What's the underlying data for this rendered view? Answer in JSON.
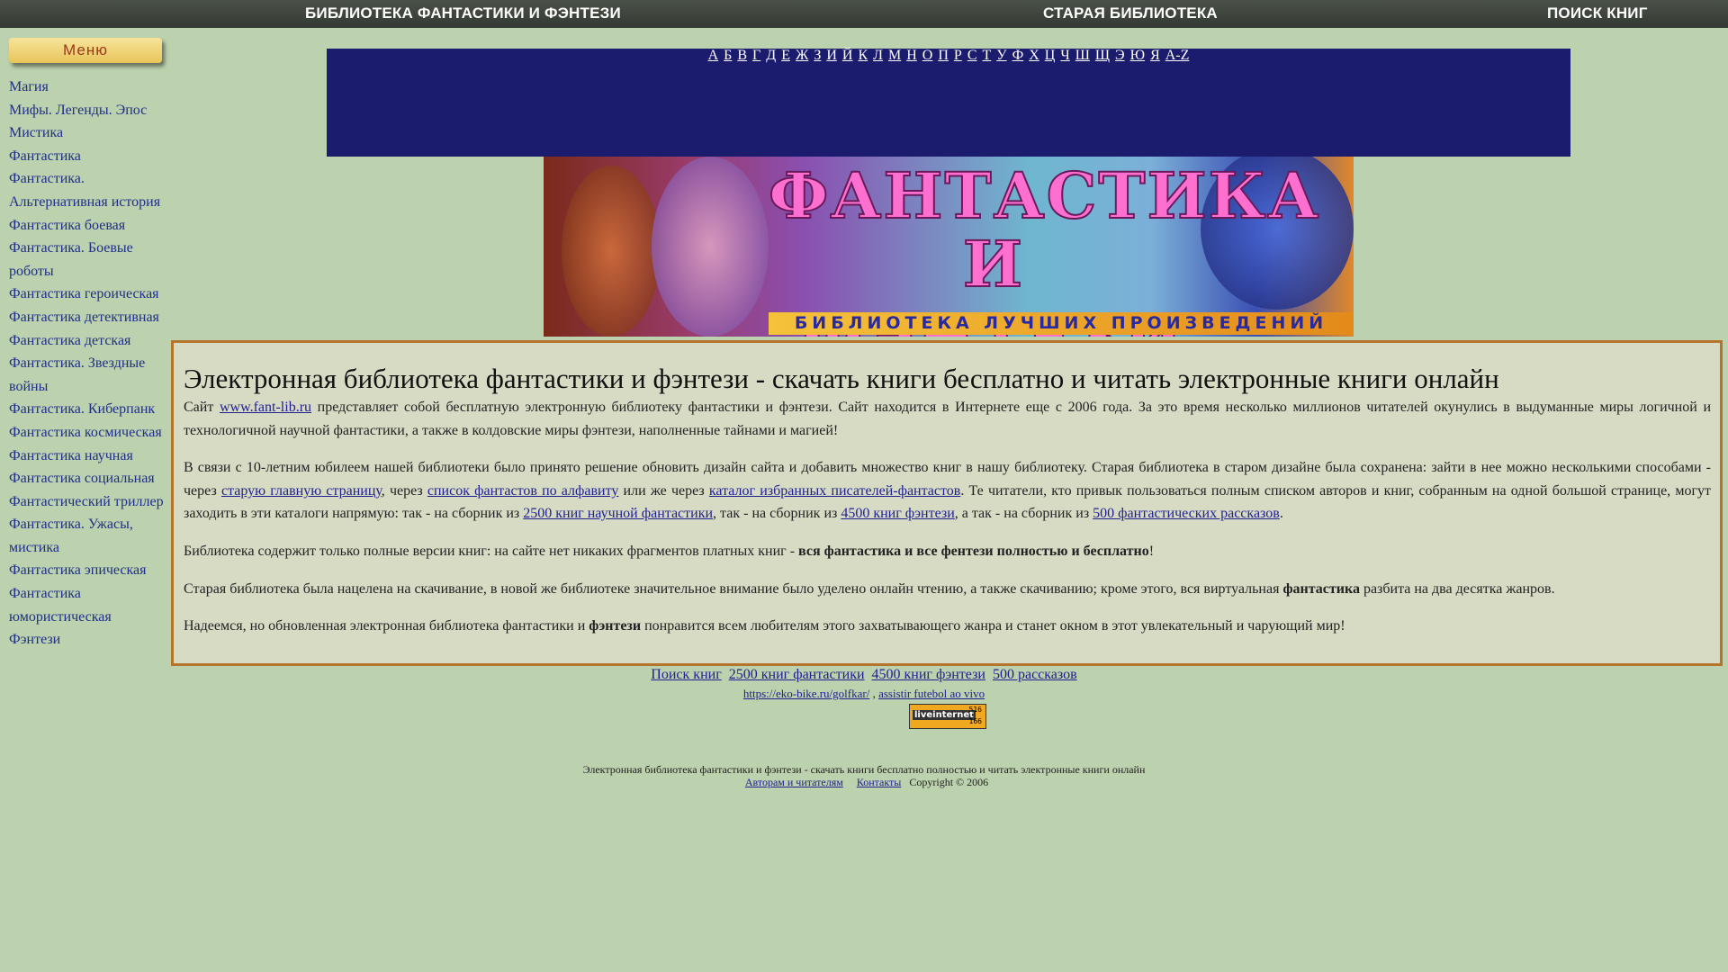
{
  "topbar": {
    "item1": "БИБЛИОТЕКА ФАНТАСТИКИ И ФЭНТЕЗИ",
    "item2": "СТАРАЯ БИБЛИОТЕКА",
    "item3": "ПОИСК КНИГ"
  },
  "sidebar": {
    "menu_label": "Меню",
    "items": [
      {
        "label": "Магия"
      },
      {
        "label": "Мифы. Легенды. Эпос"
      },
      {
        "label": "Мистика"
      },
      {
        "label": "Фантастика"
      },
      {
        "label": "Фантастика. Альтернативная история"
      },
      {
        "label": "Фантастика боевая"
      },
      {
        "label": "Фантастика. Боевые роботы"
      },
      {
        "label": "Фантастика героическая"
      },
      {
        "label": "Фантастика детективная"
      },
      {
        "label": "Фантастика детская"
      },
      {
        "label": "Фантастика. Звездные войны"
      },
      {
        "label": "Фантастика. Киберпанк"
      },
      {
        "label": "Фантастика космическая"
      },
      {
        "label": "Фантастика научная"
      },
      {
        "label": "Фантастика социальная"
      },
      {
        "label": "Фантастический триллер"
      },
      {
        "label": "Фантастика. Ужасы, мистика"
      },
      {
        "label": "Фантастика эпическая"
      },
      {
        "label": "Фантастика юмористическая"
      },
      {
        "label": "Фэнтези"
      }
    ]
  },
  "alphabet": [
    "А",
    "Б",
    "В",
    "Г",
    "Д",
    "Е",
    "Ж",
    "З",
    "И",
    "Й",
    "К",
    "Л",
    "М",
    "Н",
    "О",
    "П",
    "Р",
    "С",
    "Т",
    "У",
    "Ф",
    "Х",
    "Ц",
    "Ч",
    "Ш",
    "Щ",
    "Э",
    "Ю",
    "Я",
    "A-Z"
  ],
  "banner": {
    "title_line1": "ФАНТАСТИКА",
    "title_line2": "И ФЭНТЕЗИ",
    "subtitle": "БИБЛИОТЕКА ЛУЧШИХ ПРОИЗВЕДЕНИЙ"
  },
  "content": {
    "heading": "Электронная библиотека фантастики и фэнтези - скачать книги бесплатно и читать электронные книги онлайн",
    "p1": {
      "t1": "Сайт ",
      "link": "www.fant-lib.ru",
      "t2": " представляет собой бесплатную электронную библиотеку фантастики и фэнтези. Сайт находится в Интернете еще с 2006 года. За это время несколько миллионов читателей окунулись в выдуманные миры логичной и технологичной научной фантастики, а также в колдовские миры фэнтези, наполненные тайнами и магией!"
    },
    "p2": {
      "t1": "В связи с 10-летним юбилеем нашей библиотеки было принято решение обновить дизайн сайта и добавить множество книг в нашу библиотеку. Старая библиотека в старом дизайне была сохранена: зайти в нее можно несколькими способами - через ",
      "link1": "старую главную страницу",
      "t2": ", через ",
      "link2": "список фантастов по алфавиту",
      "t3": " или же через ",
      "link3": "каталог избранных писателей-фантастов",
      "t4": ". Те читатели, кто привык пользоваться полным списком авторов и книг, собранным на одной большой странице, могут заходить в эти каталоги напрямую: так - на сборник из ",
      "link4": "2500 книг научной фантастики",
      "t5": ", так - на сборник из ",
      "link5": "4500 книг фэнтези",
      "t6": ", а так - на сборник из ",
      "link6": "500 фантастических рассказов",
      "t7": "."
    },
    "p3": {
      "t1": "Библиотека содержит только полные версии книг: на сайте нет никаких фрагментов платных книг - ",
      "bold": "вся фантастика и все фентези полностью и бесплатно",
      "t2": "!"
    },
    "p4": {
      "t1": "Старая библиотека была нацелена на скачивание, в новой же библиотеке значительное внимание было уделено онлайн чтению, а также скачиванию; кроме этого, вся виртуальная ",
      "bold": "фантастика",
      "t2": " разбита на два десятка жанров."
    },
    "p5": {
      "t1": "Надеемся, но обновленная электронная библиотека фантастики и ",
      "bold": "фэнтези",
      "t2": " понравится всем любителям этого захватывающего жанра и станет окном в этот увлекательный и чарующий мир!"
    }
  },
  "footer": {
    "links": [
      "Поиск книг",
      "2500 книг фантастики",
      "4500 книг фэнтези",
      "500 рассказов"
    ],
    "ext_link1": "https://eko-bike.ru/golfkar/",
    "ext_sep": " ,",
    "ext_link2": "assistir futebol ao vivo",
    "counter_label": "liveinternet",
    "counter_n1": "516",
    "counter_n2": "166",
    "description": "Электронная библиотека фантастики и фэнтези - скачать книги бесплатно полностью и читать электронные книги онлайн",
    "authors_link": "Авторам и читателям",
    "contacts_link": "Контакты",
    "copyright": "Copyright © 2006"
  }
}
